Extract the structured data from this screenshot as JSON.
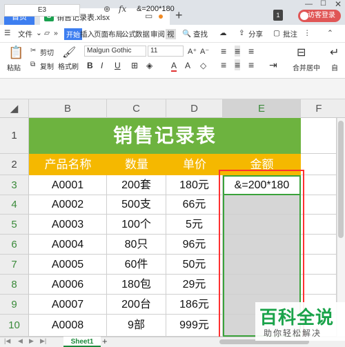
{
  "tabs": {
    "home": "首页",
    "file": "销售记录表.xlsx",
    "file_icon": "S",
    "new_tab": "+"
  },
  "window": {
    "count": "1",
    "login": "访客登录"
  },
  "menu": {
    "file": "文件",
    "start": "开始",
    "insert": "插入",
    "layout": "页面布局",
    "formula": "公式",
    "data": "数据",
    "review": "审阅",
    "more": "视",
    "find": "查找",
    "share": "分享",
    "batch": "批注"
  },
  "ribbon": {
    "cut": "剪切",
    "paste": "粘贴",
    "copy": "复制",
    "format_painter": "格式刷",
    "font": "Malgun Gothic",
    "size": "11",
    "bold": "B",
    "italic": "I",
    "underline": "U",
    "font_color": "A",
    "merge": "合并居中",
    "wrap": "自"
  },
  "formula_bar": {
    "cell_ref": "E3",
    "fx": "fx",
    "value": "&=200*180"
  },
  "grid": {
    "columns": [
      "B",
      "C",
      "D",
      "E",
      "F"
    ],
    "rows": [
      "1",
      "2",
      "3",
      "4",
      "5",
      "6",
      "7",
      "8",
      "9",
      "10"
    ],
    "title": "销售记录表",
    "headers": [
      "产品名称",
      "数量",
      "单价",
      "金额"
    ],
    "data": [
      [
        "A0001",
        "200套",
        "180元",
        "&=200*180"
      ],
      [
        "A0002",
        "500支",
        "66元",
        ""
      ],
      [
        "A0003",
        "100个",
        "5元",
        ""
      ],
      [
        "A0004",
        "80只",
        "96元",
        ""
      ],
      [
        "A0005",
        "60件",
        "50元",
        ""
      ],
      [
        "A0006",
        "180包",
        "29元",
        ""
      ],
      [
        "A0007",
        "200台",
        "186元",
        ""
      ],
      [
        "A0008",
        "9部",
        "999元",
        ""
      ]
    ]
  },
  "sheet": {
    "name": "Sheet1",
    "add": "+"
  },
  "watermark": {
    "main": "百科全说",
    "sub": "助你轻松解决"
  },
  "colors": {
    "title_bg": "#6db33f",
    "header_bg": "#f5b800",
    "selection": "#3aa23a",
    "highlight": "#ff3030"
  }
}
